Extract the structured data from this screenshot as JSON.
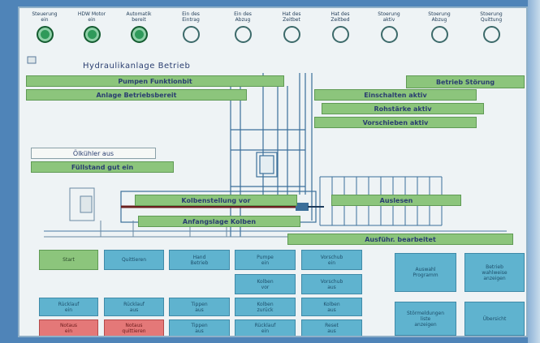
{
  "indicators": [
    {
      "label": "Steuerung\nein",
      "state": "on"
    },
    {
      "label": "HDW Motor\nein",
      "state": "on"
    },
    {
      "label": "Automatik\nbereit",
      "state": "on"
    },
    {
      "label": "Ein des\nEintrag",
      "state": "off"
    },
    {
      "label": "Ein des\nAbzug",
      "state": "off"
    },
    {
      "label": "Hat des\nZeitbet",
      "state": "off"
    },
    {
      "label": "Hat des\nZeitbed",
      "state": "off"
    },
    {
      "label": "Stoerung\naktiv",
      "state": "off"
    },
    {
      "label": "Stoerung\nAbzug",
      "state": "off"
    },
    {
      "label": "Stoerung\nQuittung",
      "state": "off"
    }
  ],
  "diagram_title": "Hydraulikanlage Betrieb",
  "status_tags": {
    "pump_ready": "Pumpen Funktionbit",
    "anlage_ready": "Anlage Betriebsbereit",
    "betrieb": "Betrieb Störung",
    "einschalten_aktiv": "Einschalten aktiv",
    "rohstaerke_aktiv": "Rohstärke aktiv",
    "vorschieben_aktiv": "Vorschieben aktiv",
    "oel_empty": "Ölkühler aus",
    "fuellstand": "Füllstand gut ein",
    "kolbenstellung": "Kolbenstellung vor",
    "auslesen": "Auslesen",
    "anfangslage": "Anfangslage Kolben",
    "zentralanzeige": "Ausführ. bearbeitet"
  },
  "buttons": {
    "row1": [
      "Start",
      "Quittieren",
      "Hand\nBetrieb",
      "Pumpe\nein",
      "Vorschub\nein"
    ],
    "row2": [
      "Kolben\nvor",
      "Vorschub\naus"
    ],
    "row3": [
      "Rücklauf\nein",
      "Rücklauf\naus",
      "Tippen\naus",
      "Kolben\nzurück",
      "Kolben\naus"
    ],
    "row4": [
      "Notaus\nein",
      "Notaus\nquittieren",
      "Tippen\naus",
      "Rücklauf\nein",
      "Reset\naus"
    ],
    "right": [
      "Auswahl\nProgramm",
      "Betrieb\nwahlweise\nanzeigen",
      "Störmeldungen\nliste\nanzeigen",
      "Übersicht"
    ]
  },
  "colors": {
    "indicator_on": "#2f9a5a",
    "tag_green": "#8cc57c",
    "button_blue": "#5fb3cf",
    "button_red": "#e47878"
  }
}
